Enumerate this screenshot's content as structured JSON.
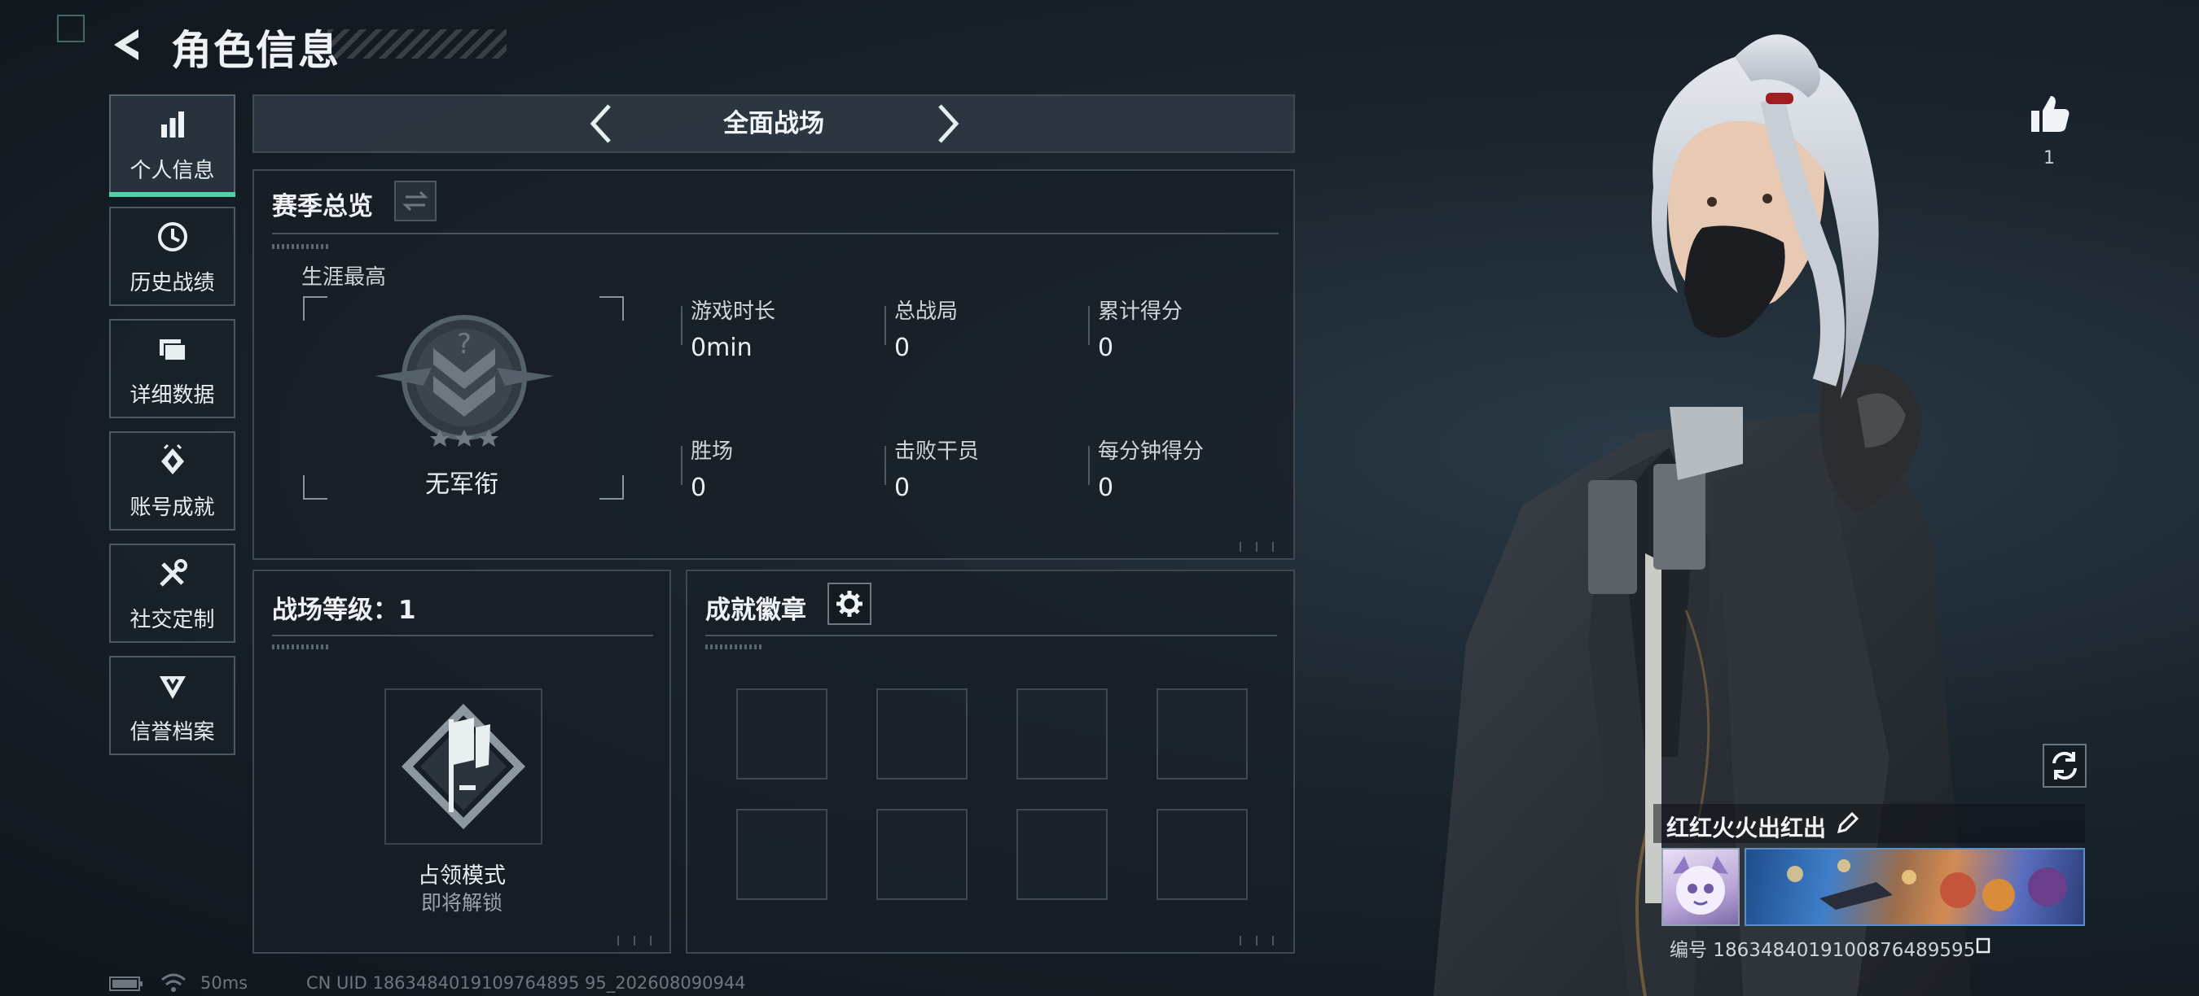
{
  "header": {
    "title": "角色信息"
  },
  "sidebar": {
    "items": [
      {
        "label": "个人信息",
        "icon": "bar-chart-icon",
        "active": true
      },
      {
        "label": "历史战绩",
        "icon": "history-clock-icon"
      },
      {
        "label": "详细数据",
        "icon": "folder-icon"
      },
      {
        "label": "账号成就",
        "icon": "achievement-icon"
      },
      {
        "label": "社交定制",
        "icon": "tools-icon"
      },
      {
        "label": "信誉档案",
        "icon": "credit-shield-icon"
      }
    ]
  },
  "mode_selector": {
    "label": "全面战场"
  },
  "season": {
    "title": "赛季总览",
    "career_label": "生涯最高",
    "rank_name": "无军衔",
    "stats": [
      {
        "label": "游戏时长",
        "value": "0min"
      },
      {
        "label": "总战局",
        "value": "0"
      },
      {
        "label": "累计得分",
        "value": "0"
      },
      {
        "label": "胜场",
        "value": "0"
      },
      {
        "label": "击败干员",
        "value": "0"
      },
      {
        "label": "每分钟得分",
        "value": "0"
      }
    ]
  },
  "battlefield": {
    "title": "战场等级：1",
    "mode_name": "占领模式",
    "mode_status": "即将解锁"
  },
  "badges": {
    "title": "成就徽章",
    "slot_count": 8
  },
  "character": {
    "like_count": "1",
    "player_name": "红红火火出红出",
    "uid_text": "编号 1863484019100876489595"
  },
  "status_bar": {
    "ping": "50ms",
    "uid_line": "CN UID 1863484019109764895 95_202608090944"
  },
  "colors": {
    "accent": "#4fd3a6",
    "panel_border": "#3c4852",
    "background": "#1b252e"
  }
}
